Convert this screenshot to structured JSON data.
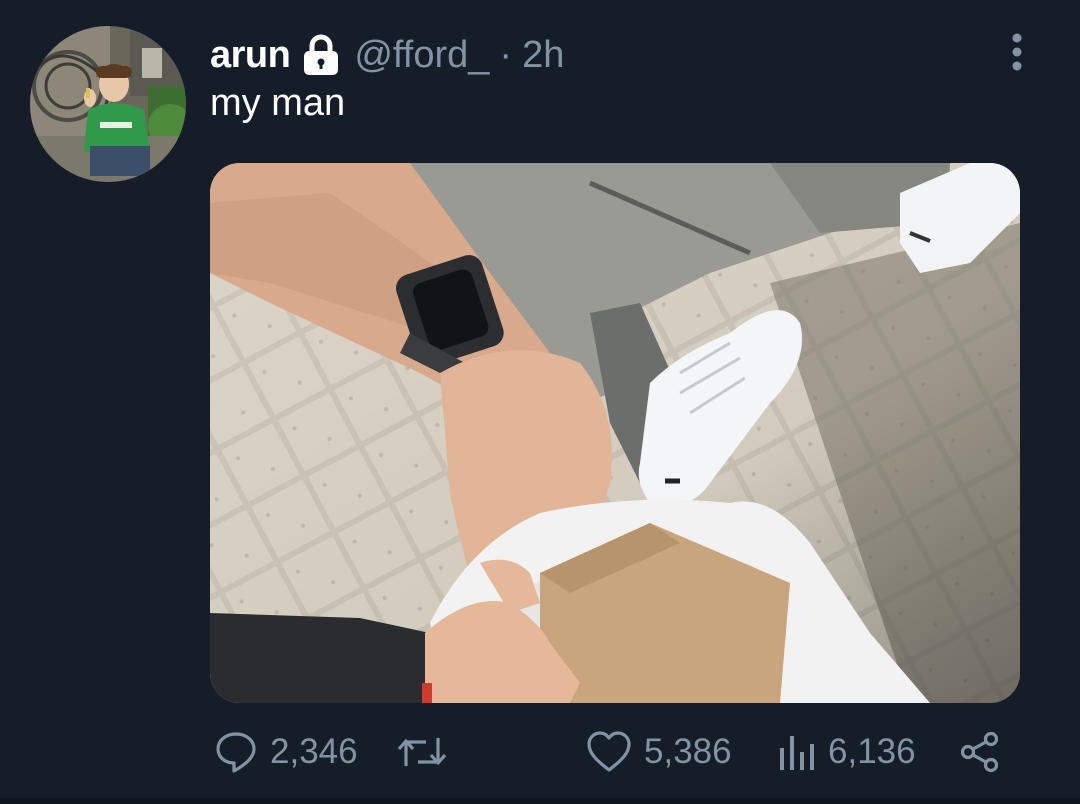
{
  "tweet": {
    "display_name": "arun",
    "handle": "@fford_",
    "separator": "·",
    "time": "2h",
    "text": "my man"
  },
  "actions": {
    "replies": "2,346",
    "likes": "5,386",
    "views": "6,136"
  },
  "icons": {
    "lock": "lock-icon",
    "more": "more-vertical-icon",
    "reply": "reply-icon",
    "retweet": "retweet-icon",
    "like": "heart-icon",
    "views": "views-icon",
    "share": "share-icon"
  },
  "colors": {
    "background": "#151e28",
    "primary_text": "#ffffff",
    "secondary_text": "#8493a3"
  }
}
